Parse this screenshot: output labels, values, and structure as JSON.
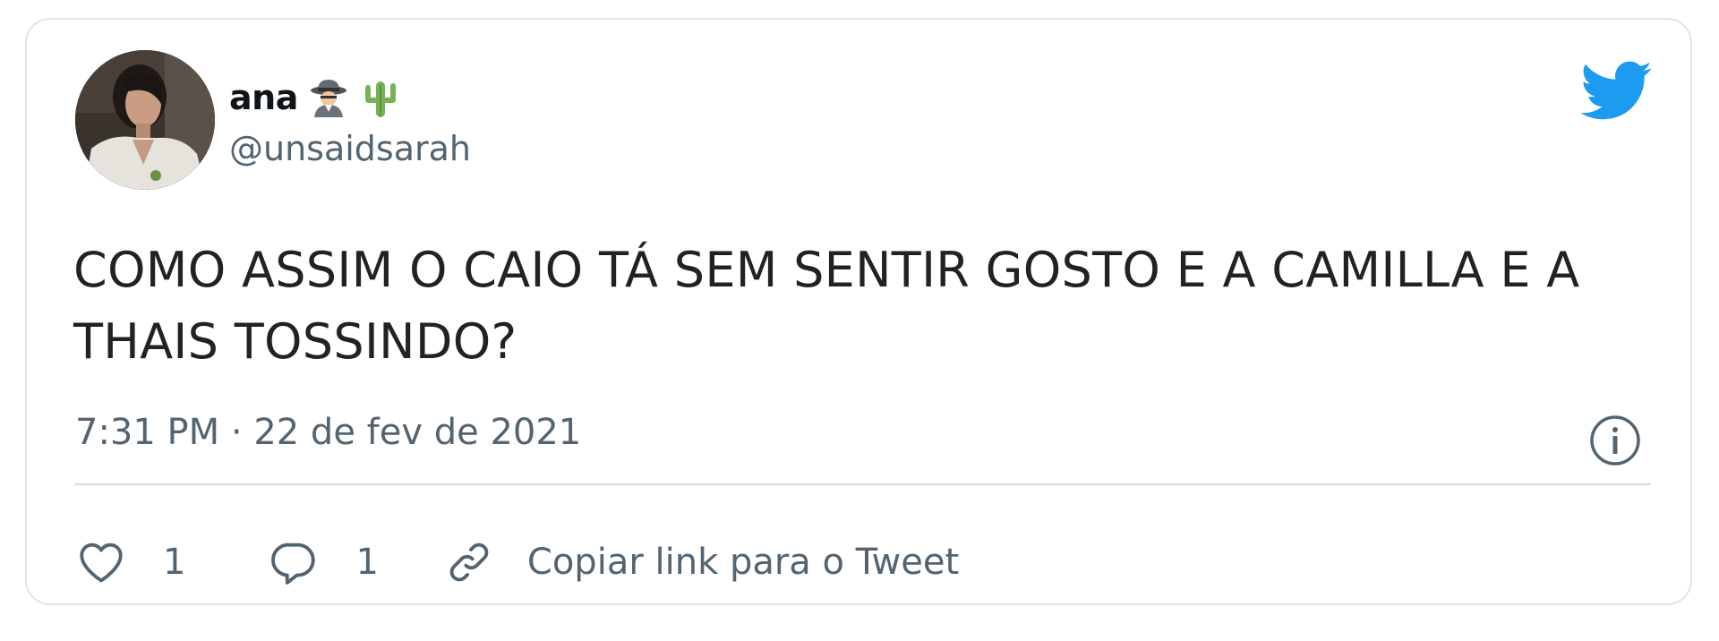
{
  "author": {
    "display_name": "ana",
    "emojis": [
      "detective-emoji",
      "cactus-emoji"
    ],
    "handle": "@unsaidsarah"
  },
  "tweet": {
    "text": "COMO ASSIM O CAIO TÁ SEM SENTIR GOSTO E A CAMILLA E A THAIS TOSSINDO?",
    "timestamp": "7:31 PM · 22 de fev de 2021"
  },
  "actions": {
    "like_count": "1",
    "reply_count": "1",
    "copy_link_label": "Copiar link para o Tweet"
  },
  "icons": {
    "brand": "twitter-bird-icon",
    "info": "info-icon",
    "like": "heart-icon",
    "reply": "reply-bubble-icon",
    "copy": "link-icon"
  },
  "colors": {
    "twitter_blue": "#1d9bf0",
    "text_primary": "#0f1419",
    "text_secondary": "#536471",
    "border": "#dfe4e8"
  }
}
